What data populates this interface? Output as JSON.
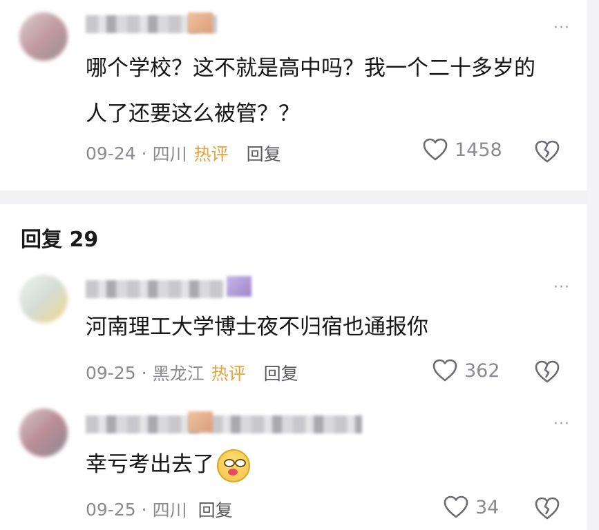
{
  "top_comment": {
    "text": "哪个学校？这不就是高中吗？我一个二十多岁的人了还要这么被管？？",
    "date": "09-24",
    "location": "四川",
    "hot_label": "热评",
    "reply_label": "回复",
    "likes": "1458"
  },
  "replies_header": "回复 29",
  "replies": [
    {
      "text": "河南理工大学博士夜不归宿也通报你",
      "date": "09-25",
      "location": "黑龙江",
      "hot_label": "热评",
      "reply_label": "回复",
      "likes": "362"
    },
    {
      "text": "幸亏考出去了",
      "date": "09-25",
      "location": "四川",
      "reply_label": "回复",
      "likes": "34",
      "emoji": "drooling-face-emoji"
    }
  ],
  "separator": "·",
  "more_glyph": "···",
  "colors": {
    "hot": "#e9a23b",
    "meta": "#8a8a90",
    "band": "#f1f1f3"
  }
}
